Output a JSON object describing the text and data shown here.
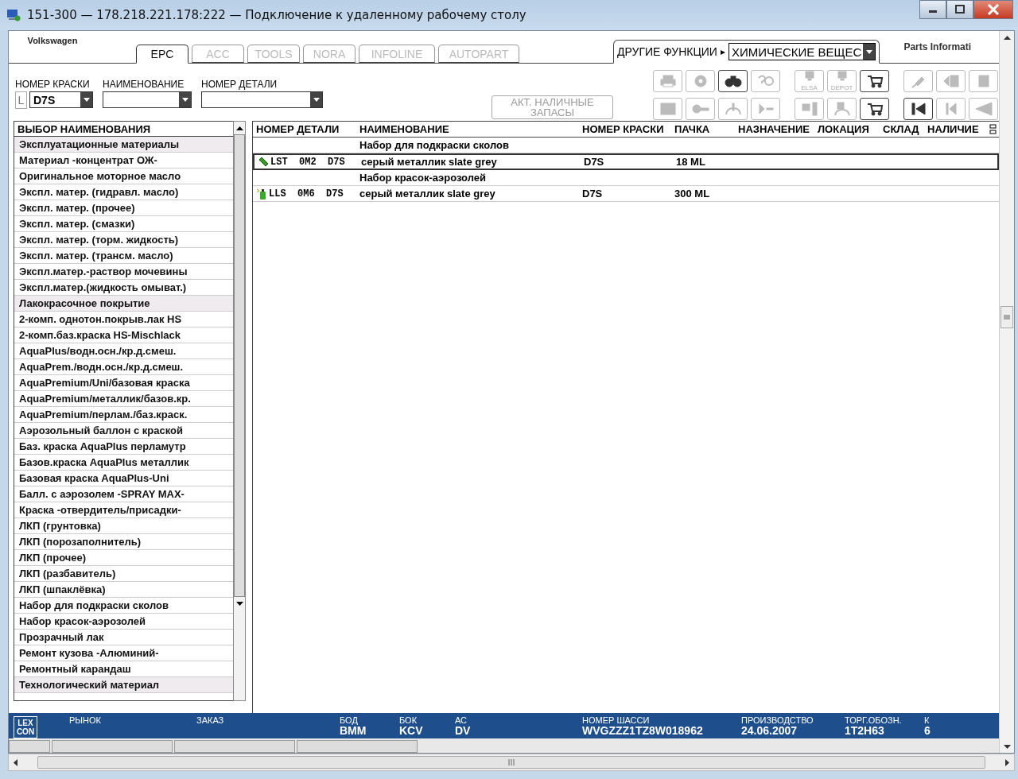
{
  "window": {
    "title": "151-300 — 178.218.221.178:222 — Подключение к удаленному рабочему столу"
  },
  "brand": {
    "name": "Volkswagen",
    "right_logo": "Parts Informati"
  },
  "tabs": [
    {
      "label": "EPC",
      "selected": true,
      "disabled": false
    },
    {
      "label": "ACC",
      "selected": false,
      "disabled": true
    },
    {
      "label": "TOOLS",
      "selected": false,
      "disabled": true
    },
    {
      "label": "NORA",
      "selected": false,
      "disabled": true
    },
    {
      "label": "INFOLINE",
      "selected": false,
      "disabled": true
    },
    {
      "label": "AUTOPART",
      "selected": false,
      "disabled": true
    }
  ],
  "other_functions": {
    "label": "ДРУГИЕ ФУНКЦИИ",
    "arrow": "▸",
    "value": "ХИМИЧЕСКИЕ ВЕЩЕС"
  },
  "filters": [
    {
      "label": "НОМЕР КРАСКИ",
      "prefix": "L",
      "value": "D7S"
    },
    {
      "label": "НАИМЕНОВАНИЕ"
    },
    {
      "label": "НОМЕР ДЕТАЛИ"
    }
  ],
  "stock_button": {
    "label": "АКТ. НАЛИЧНЫЕ ЗАПАСЫ",
    "disabled": true
  },
  "toolbar": [
    [
      {
        "kind": "printer",
        "disabled": true
      },
      {
        "kind": "tire",
        "disabled": true
      },
      {
        "kind": "binoculars",
        "disabled": false
      },
      {
        "kind": "help",
        "disabled": true
      },
      {
        "kind": "screen",
        "caption": "ELSA",
        "disabled": true
      },
      {
        "kind": "screen",
        "caption": "DEPOT",
        "disabled": true
      },
      {
        "kind": "carts",
        "disabled": false
      },
      {
        "kind": "pin",
        "disabled": true
      },
      {
        "kind": "page-left",
        "disabled": true
      },
      {
        "kind": "page",
        "disabled": true
      }
    ],
    [
      {
        "kind": "list",
        "disabled": true
      },
      {
        "kind": "key",
        "disabled": true
      },
      {
        "kind": "car-info",
        "disabled": true
      },
      {
        "kind": "play-dash",
        "disabled": true
      },
      {
        "kind": "screen-list",
        "disabled": true
      },
      {
        "kind": "car-doc",
        "disabled": true
      },
      {
        "kind": "cart",
        "disabled": false
      },
      {
        "kind": "first",
        "disabled": false
      },
      {
        "kind": "prev",
        "disabled": true
      },
      {
        "kind": "back",
        "disabled": true
      }
    ]
  ],
  "category_list": {
    "title": "ВЫБОР НАИМЕНОВАНИЯ",
    "items": [
      {
        "label": "Эксплуатационные материалы",
        "kind": "group"
      },
      {
        "label": "Материал -концентрат ОЖ-",
        "kind": "item"
      },
      {
        "label": "Оригинальное моторное масло",
        "kind": "item"
      },
      {
        "label": "Экспл. матер. (гидравл. масло)",
        "kind": "item"
      },
      {
        "label": "Экспл. матер. (прочее)",
        "kind": "item"
      },
      {
        "label": "Экспл. матер. (смазки)",
        "kind": "item"
      },
      {
        "label": "Экспл. матер. (торм. жидкость)",
        "kind": "item"
      },
      {
        "label": "Экспл. матер. (трансм. масло)",
        "kind": "item"
      },
      {
        "label": "Экспл.матер.-раствор мочевины",
        "kind": "item"
      },
      {
        "label": "Экспл.матер.(жидкость омыват.)",
        "kind": "item"
      },
      {
        "label": "Лакокрасочное покрытие",
        "kind": "group"
      },
      {
        "label": "2-комп. однотон.покрыв.лак HS",
        "kind": "item"
      },
      {
        "label": "2-комп.баз.краска HS-Mischlack",
        "kind": "item"
      },
      {
        "label": "AquaPlus/водн.осн./кр.д.смеш.",
        "kind": "item"
      },
      {
        "label": "AquaPrem./водн.осн./кр.д.смеш.",
        "kind": "item"
      },
      {
        "label": "AquaPremium/Uni/базовая краска",
        "kind": "item"
      },
      {
        "label": "AquaPremium/металлик/базов.кр.",
        "kind": "item"
      },
      {
        "label": "AquaPremium/перлам./баз.краск.",
        "kind": "item"
      },
      {
        "label": "Аэрозольный баллон с краской",
        "kind": "item"
      },
      {
        "label": "Баз. краска AquaPlus перламутр",
        "kind": "item"
      },
      {
        "label": "Базов.краска AquaPlus металлик",
        "kind": "item"
      },
      {
        "label": "Базовая краска AquaPlus-Uni",
        "kind": "item"
      },
      {
        "label": "Балл. с аэрозолем  -SPRAY MAX-",
        "kind": "item"
      },
      {
        "label": "Краска -отвердитель/присадки-",
        "kind": "item"
      },
      {
        "label": "ЛКП (грунтовка)",
        "kind": "item"
      },
      {
        "label": "ЛКП (порозаполнитель)",
        "kind": "item"
      },
      {
        "label": "ЛКП (прочее)",
        "kind": "item"
      },
      {
        "label": "ЛКП (разбавитель)",
        "kind": "item"
      },
      {
        "label": "ЛКП (шпаклёвка)",
        "kind": "item"
      },
      {
        "label": "Набор для подкраски сколов",
        "kind": "item"
      },
      {
        "label": "Набор красок-аэрозолей",
        "kind": "item"
      },
      {
        "label": "Прозрачный лак",
        "kind": "item"
      },
      {
        "label": "Ремонт кузова -Алюминий-",
        "kind": "item"
      },
      {
        "label": "Ремонтный карандаш",
        "kind": "item"
      },
      {
        "label": "Технологический материал",
        "kind": "group"
      }
    ]
  },
  "table": {
    "columns": [
      "НОМЕР ДЕТАЛИ",
      "НАИМЕНОВАНИЕ",
      "НОМЕР КРАСКИ",
      "ПАЧКА",
      "НАЗНАЧЕНИЕ",
      "ЛОКАЦИЯ",
      "СКЛАД",
      "НАЛИЧИЕ"
    ],
    "rows": [
      {
        "kind": "group",
        "title": "Набор для подкраски сколов"
      },
      {
        "kind": "part",
        "part_number": "LST  0M2  D7S",
        "name": "серый металлик slate grey",
        "paint": "D7S",
        "pack": "18 ML",
        "selected": true
      },
      {
        "kind": "group",
        "title": "Набор красок-аэрозолей"
      },
      {
        "kind": "part",
        "part_number": "LLS  0M6  D7S",
        "name": "серый металлик slate grey",
        "paint": "D7S",
        "pack": "300 ML",
        "selected": false
      }
    ]
  },
  "status_bar": [
    {
      "label": "РЫНОК"
    },
    {
      "label": "ЗАКАЗ"
    },
    {
      "label": "БОД",
      "value": "BMM"
    },
    {
      "label": "БОК",
      "value": "KCV"
    },
    {
      "label": "АС",
      "value": "DV"
    },
    {
      "label": "НОМЕР ШАССИ",
      "value": "WVGZZZ1TZ8W018962"
    },
    {
      "label": "ПРОИЗВОДСТВО",
      "value": "24.06.2007"
    },
    {
      "label": "ТОРГ.ОБОЗН.",
      "value": "1T2H63"
    },
    {
      "label": "К",
      "value": "6"
    }
  ],
  "status_logo": [
    "LEX",
    "CON"
  ]
}
